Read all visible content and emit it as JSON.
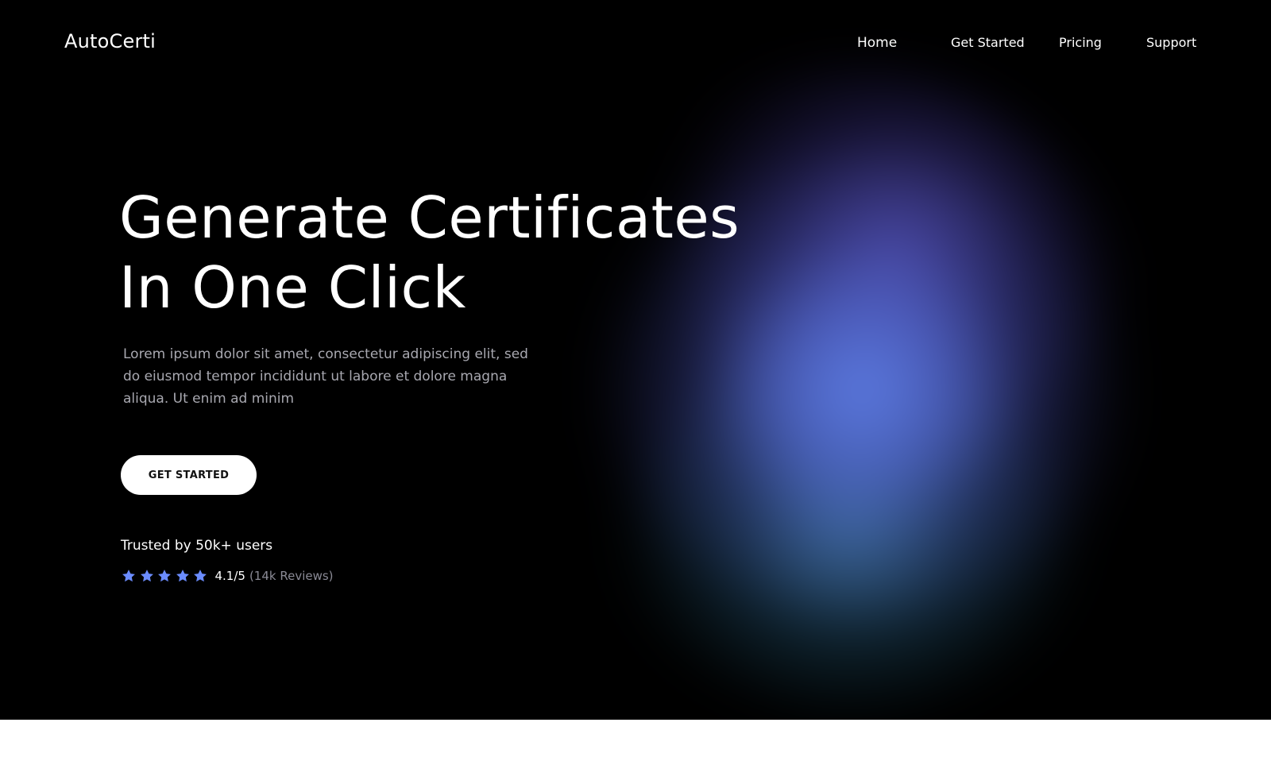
{
  "brand": {
    "logo_text": "AutoCerti"
  },
  "nav": {
    "items": [
      {
        "label": "Home"
      },
      {
        "label": "Get Started"
      },
      {
        "label": "Pricing"
      },
      {
        "label": "Support"
      }
    ]
  },
  "hero": {
    "headline_line1": "Generate Certificates",
    "headline_line2": "In One Click",
    "description": "Lorem ipsum dolor sit amet, consectetur adipiscing elit, sed do eiusmod tempor incididunt ut labore et dolore magna aliqua. Ut enim ad minim",
    "cta_label": "GET STARTED",
    "trusted_text": "Trusted by 50k+ users",
    "rating": {
      "stars": 5,
      "score_text": "4.1/5",
      "reviews_text": "(14k Reviews)"
    }
  },
  "colors": {
    "background": "#000000",
    "star": "#6b8cff",
    "cta_background": "#ffffff",
    "muted_text": "#a8a8b0"
  }
}
